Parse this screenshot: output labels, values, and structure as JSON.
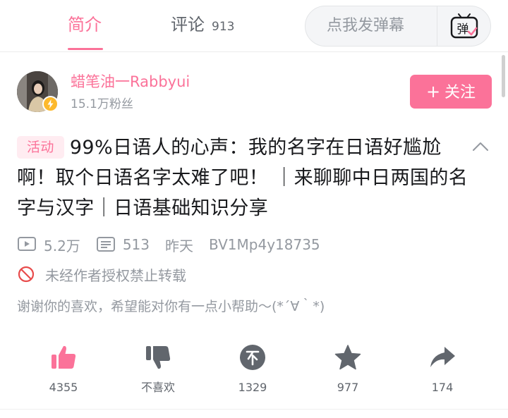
{
  "tabs": {
    "intro": "简介",
    "comments": "评论",
    "comment_count": "913"
  },
  "danmaku": {
    "placeholder": "点我发弹幕",
    "toggle_label": "弹"
  },
  "author": {
    "name": "蜡笔油一Rabbyui",
    "followers": "15.1万粉丝",
    "follow_label": "关注"
  },
  "video": {
    "tag": "活动",
    "title": "99%日语人的心声：我的名字在日语好尴尬啊！取个日语名字太难了吧！ ｜来聊聊中日两国的名字与汉字｜日语基础知识分享",
    "views": "5.2万",
    "danmaku_count": "513",
    "date": "昨天",
    "bvid": "BV1Mp4y18735",
    "notice": "未经作者授权禁止转载",
    "description": "谢谢你的喜欢，希望能对你有一点小帮助～(*´∀｀*)"
  },
  "actions": {
    "like": "4355",
    "dislike": "不喜欢",
    "coin": "1329",
    "favorite": "977",
    "share": "174"
  },
  "colors": {
    "accent": "#fb7299",
    "icon_gray": "#61666d",
    "text_secondary": "#9499a0"
  }
}
